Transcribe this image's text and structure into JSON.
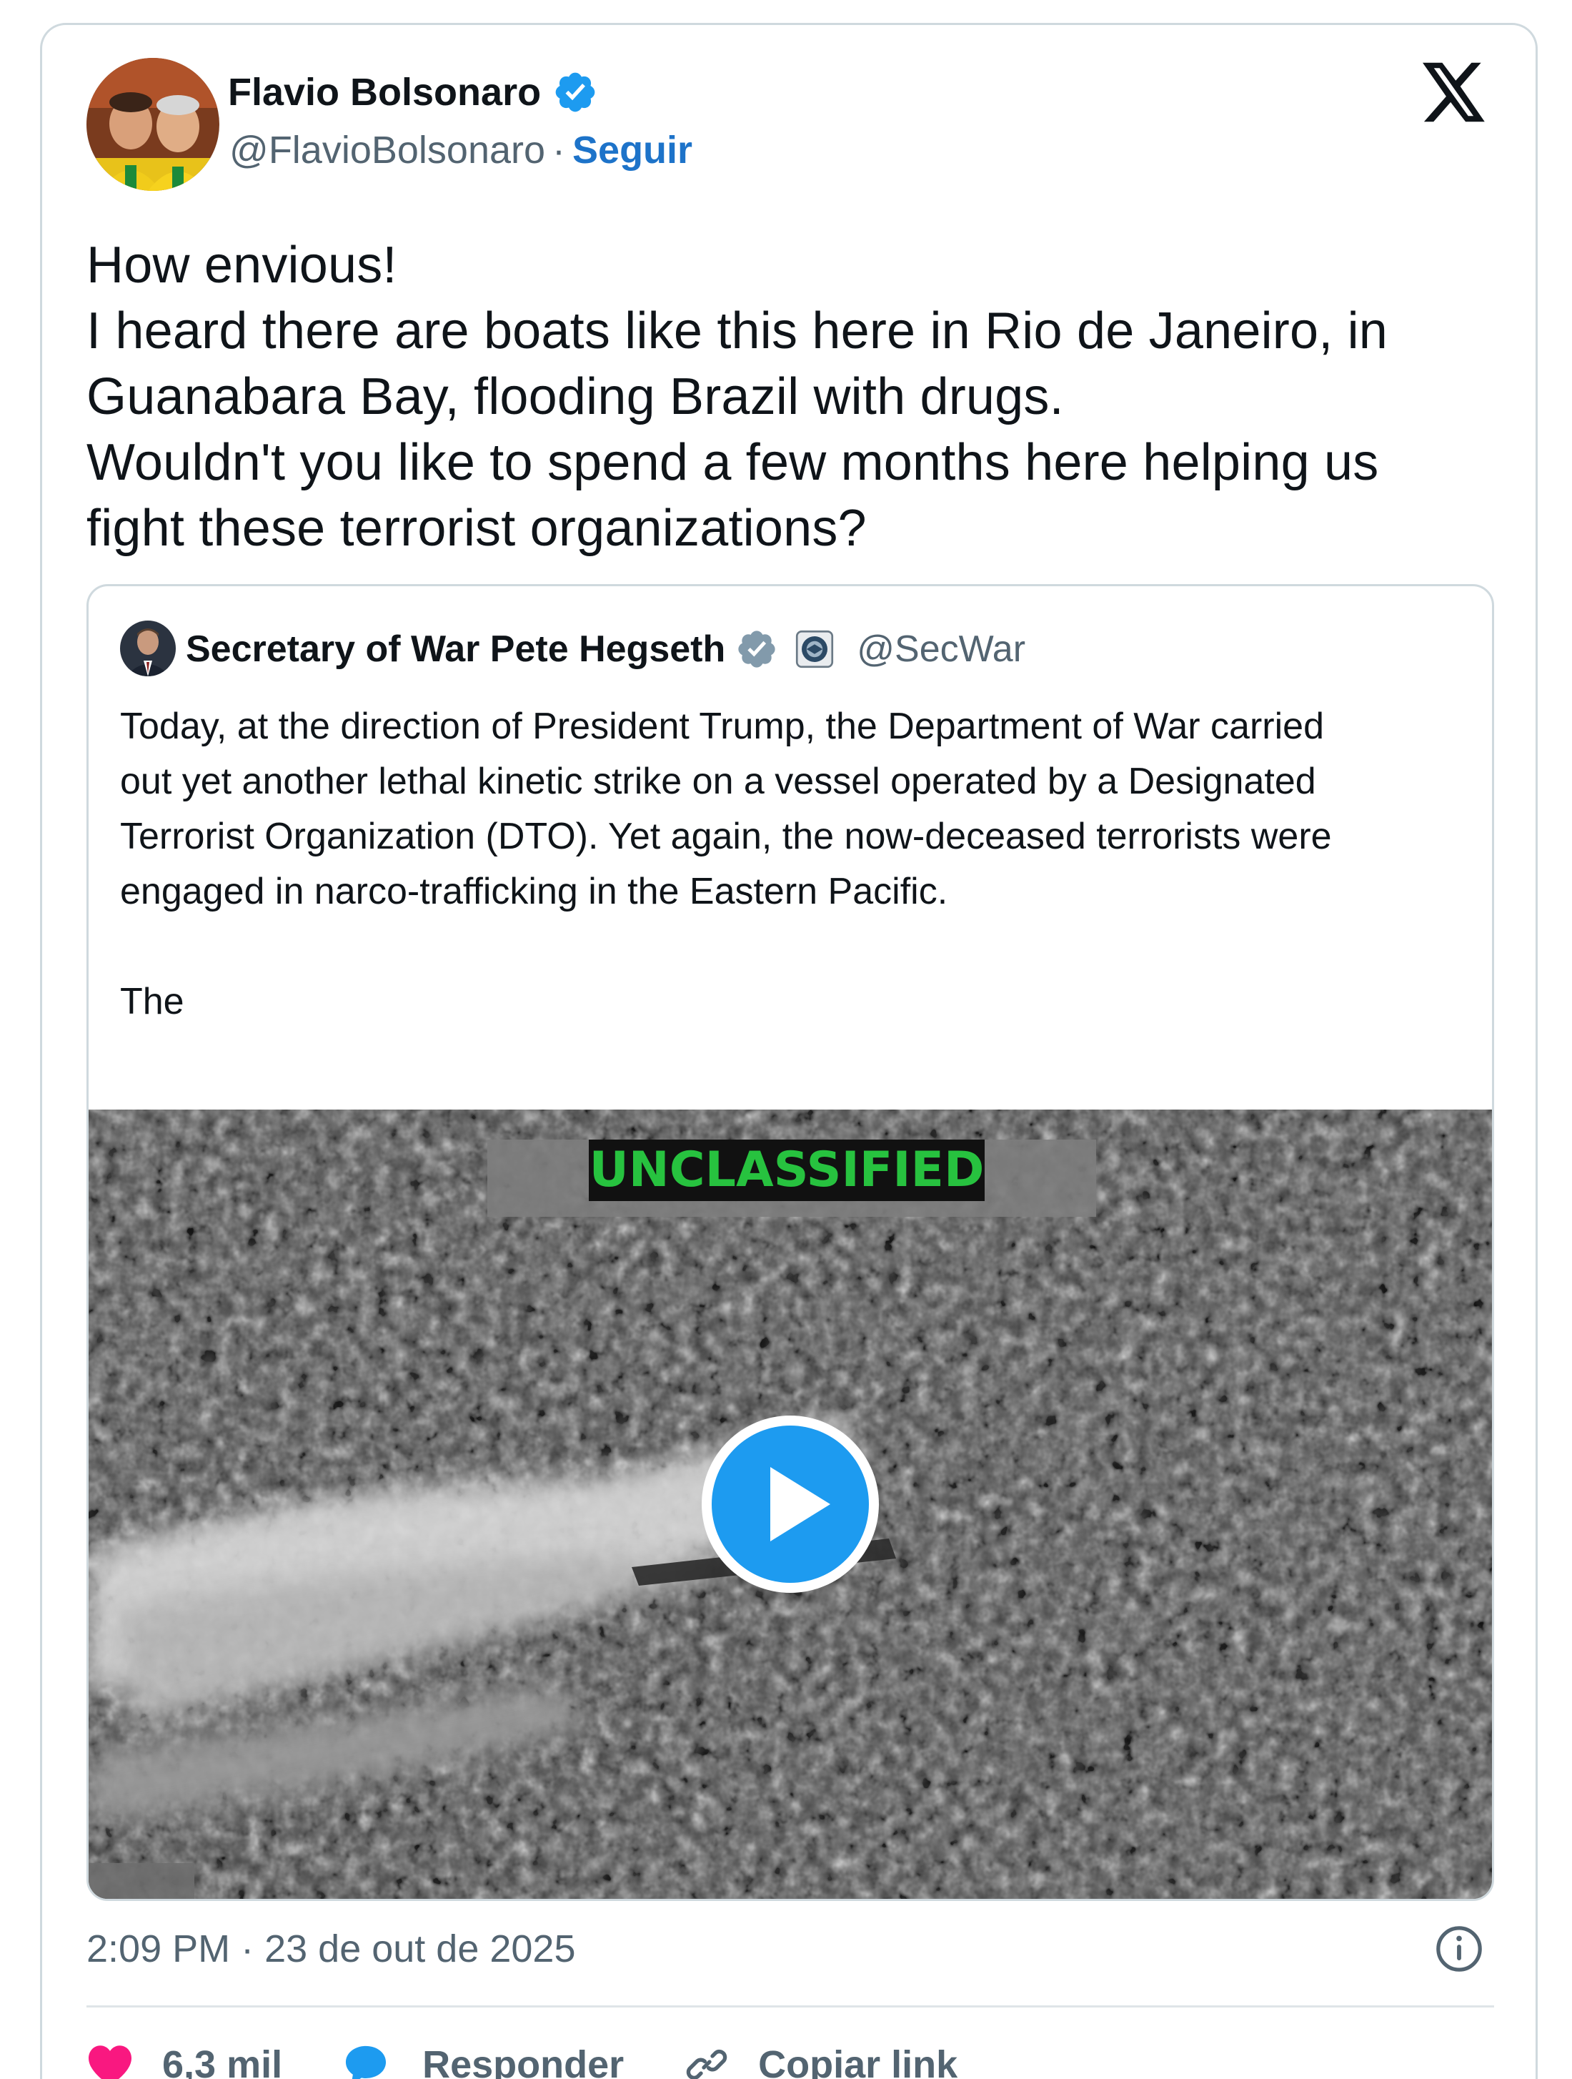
{
  "author": {
    "name": "Flavio Bolsonaro",
    "handle": "@FlavioBolsonaro",
    "separator": "·",
    "follow_label": "Seguir",
    "verified_icon": "verified-badge-icon",
    "avatar_icon": "avatar"
  },
  "brand_icon": "x-logo-icon",
  "tweet": {
    "lines": [
      "How envious!",
      "I heard there are boats like this here in Rio de Janeiro, in",
      "Guanabara Bay, flooding Brazil with drugs.",
      "Wouldn't you like to spend a few months here helping us",
      "fight these terrorist organizations?"
    ]
  },
  "quote": {
    "name": "Secretary of War Pete Hegseth",
    "handle": "@SecWar",
    "verified_icon": "gray-verified-badge-icon",
    "affiliation_icon": "department-seal-icon",
    "lines": [
      "Today, at the direction of President Trump, the Department of War carried",
      "out yet another lethal kinetic strike on a vessel operated by a Designated",
      "Terrorist Organization (DTO). Yet again, the now-deceased terrorists were",
      "engaged in narco-trafficking in the Eastern Pacific."
    ],
    "truncated_text": "The",
    "media": {
      "classification_label": "UNCLASSIFIED",
      "play_icon": "play-icon"
    }
  },
  "footer": {
    "timestamp": "2:09 PM · 23 de out de 2025",
    "info_icon": "info-icon",
    "likes_count": "6,3 mil",
    "reply_label": "Responder",
    "copy_link_label": "Copiar link"
  },
  "colors": {
    "link_blue": "#1d73c9",
    "like_pink": "#f91880",
    "reply_blue": "#1d9bf0",
    "muted_text": "#536471",
    "border": "#cfd9de",
    "classification_green": "#27c23f"
  }
}
